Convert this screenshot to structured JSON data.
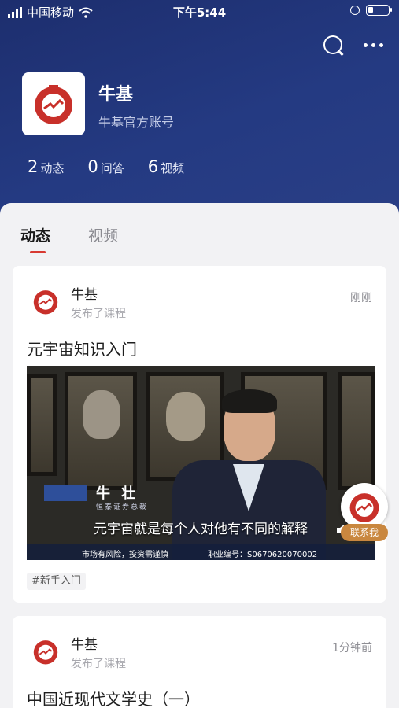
{
  "status_bar": {
    "carrier": "中国移动",
    "time": "下午5:44"
  },
  "profile": {
    "name": "牛基",
    "subtitle": "牛基官方账号"
  },
  "stats": [
    {
      "num": "2",
      "label": "动态"
    },
    {
      "num": "0",
      "label": "问答"
    },
    {
      "num": "6",
      "label": "视频"
    }
  ],
  "tabs": [
    {
      "label": "动态"
    },
    {
      "label": "视频"
    }
  ],
  "posts": [
    {
      "author": "牛基",
      "action": "发布了课程",
      "time": "刚刚",
      "title": "元宇宙知识入门",
      "video": {
        "caption_name": "牛 壮",
        "caption_role": "恒泰证券总裁",
        "subtitle": "元宇宙就是每个人对他有不同的解释",
        "risk_notice": "市场有风险，投资需谨慎",
        "license": "职业编号：S0670620070002"
      },
      "tag": "#新手入门"
    },
    {
      "author": "牛基",
      "action": "发布了课程",
      "time": "1分钟前",
      "title": "中国近现代文学史（一）"
    }
  ],
  "contact": {
    "label": "联系我"
  },
  "colors": {
    "header": "#1d2e6e",
    "accent": "#d83a32",
    "brand_red": "#c8302a"
  }
}
